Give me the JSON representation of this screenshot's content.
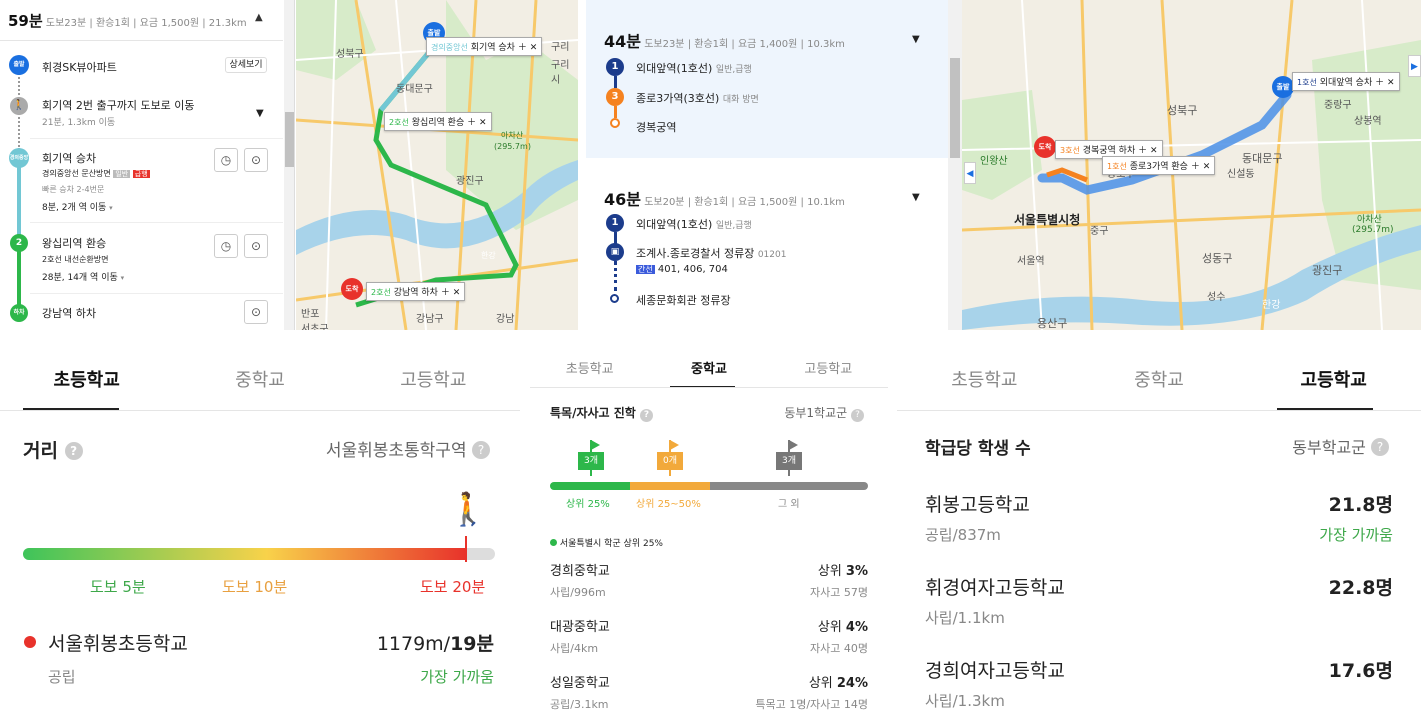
{
  "route1": {
    "time": "59분",
    "walk": "도보23분",
    "transfer": "환승1회",
    "fare": "요금 1,500원",
    "distance": "21.3km",
    "start_badge": "출발",
    "start_place": "휘경SK뷰아파트",
    "detail_btn": "상세보기",
    "walk_text": "회기역 2번 출구까지 도보로 이동",
    "walk_sub": "21분, 1.3km 이동",
    "board_badge": "경의중앙",
    "board_title": "회기역 승차",
    "board_line": "경의중앙선 문산방면",
    "board_tag1": "일반",
    "board_tag2": "급행",
    "board_fast": "빠른 승차 2-4번문",
    "board_info": "8분, 2개 역 이동",
    "transfer_badge": "2",
    "transfer_title": "왕십리역 환승",
    "transfer_line": "2호선 내선순환방면",
    "transfer_info": "28분, 14개 역 이동",
    "end_badge": "하차",
    "end_title": "강남역 하차"
  },
  "map1": {
    "labels": [
      "성북구",
      "동대문구",
      "광진구",
      "아차산",
      "(295.7m)",
      "구리시",
      "강남구",
      "서초구",
      "반포",
      "한강",
      "구리",
      "강남"
    ],
    "start_tag_line": "경의중앙선",
    "start_tag": "회기역 승차",
    "start_marker": "출발",
    "transfer_tag_line": "2호선",
    "transfer_tag": "왕십리역 환승",
    "end_tag_line": "2호선",
    "end_tag": "강남역 하차",
    "end_marker": "도착"
  },
  "route2": {
    "time": "44분",
    "walk": "도보23분",
    "transfer": "환승1회",
    "fare": "요금 1,400원",
    "distance": "10.3km",
    "s1_badge": "1",
    "s1": "외대앞역(1호선)",
    "s1_type": "일반,급행",
    "s2_badge": "3",
    "s2": "종로3가역(3호선)",
    "s2_dir": "대화 방면",
    "s3": "경복궁역"
  },
  "route3": {
    "time": "46분",
    "walk": "도보20분",
    "transfer": "환승1회",
    "fare": "요금 1,500원",
    "distance": "10.1km",
    "s1_badge": "1",
    "s1": "외대앞역(1호선)",
    "s1_type": "일반,급행",
    "s2": "조계사.종로경찰서 정류장",
    "s2_code": "01201",
    "s2_bus_tag": "간선",
    "s2_bus": "401, 406, 704",
    "s3": "세종문화회관 정류장"
  },
  "map2": {
    "labels": [
      "성북구",
      "동대문구",
      "인왕산",
      "종로구",
      "서울특별시청",
      "중구",
      "서울역",
      "성동구",
      "광진구",
      "아차산",
      "(295.7m)",
      "용산구",
      "중랑구",
      "성수",
      "상봉역",
      "신설동",
      "한강"
    ],
    "start_tag_line": "1호선",
    "start_tag": "외대앞역 승차",
    "start_marker": "출발",
    "end_tag_line": "3호선",
    "end_tag": "경복궁역 하차",
    "end_marker": "도착",
    "transfer_tag_line": "1호선",
    "transfer_tag": "종로3가역 환승"
  },
  "elem": {
    "tabs": [
      "초등학교",
      "중학교",
      "고등학교"
    ],
    "distance_title": "거리",
    "district": "서울휘봉초통학구역",
    "scale": [
      "도보 5분",
      "도보 10분",
      "도보 20분"
    ],
    "school_name": "서울휘봉초등학교",
    "school_type": "공립",
    "school_dist": "1179m/",
    "school_time": "19분",
    "nearest": "가장 가까움"
  },
  "middle": {
    "tabs": [
      "초등학교",
      "중학교",
      "고등학교"
    ],
    "title": "특목/자사고 진학",
    "district": "동부1학교군",
    "flags": [
      "3개",
      "0개",
      "3개"
    ],
    "ranges": [
      "상위 25%",
      "상위 25~50%",
      "그 외"
    ],
    "legend": "서울특별시 학군 상위 25%",
    "schools": [
      {
        "name": "경희중학교",
        "sub": "사립/996m",
        "rank_label": "상위",
        "rank": "3%",
        "extra": "자사고 57명"
      },
      {
        "name": "대광중학교",
        "sub": "사립/4km",
        "rank_label": "상위",
        "rank": "4%",
        "extra": "자사고 40명"
      },
      {
        "name": "성일중학교",
        "sub": "공립/3.1km",
        "rank_label": "상위",
        "rank": "24%",
        "extra": "특목고 1명/자사고 14명"
      }
    ]
  },
  "high": {
    "tabs": [
      "초등학교",
      "중학교",
      "고등학교"
    ],
    "title": "학급당 학생 수",
    "district": "동부학교군",
    "schools": [
      {
        "name": "휘봉고등학교",
        "sub": "공립/837m",
        "value": "21.8명",
        "note": "가장 가까움"
      },
      {
        "name": "휘경여자고등학교",
        "sub": "사립/1.1km",
        "value": "22.8명",
        "note": ""
      },
      {
        "name": "경희여자고등학교",
        "sub": "사립/1.3km",
        "value": "17.6명",
        "note": ""
      }
    ]
  },
  "colors": {
    "line1": "#1c3c8c",
    "line2": "#2db74a",
    "line3": "#f58220",
    "gyeongui": "#72c7d4",
    "green_text": "#3ea84a",
    "red": "#e8322b"
  }
}
